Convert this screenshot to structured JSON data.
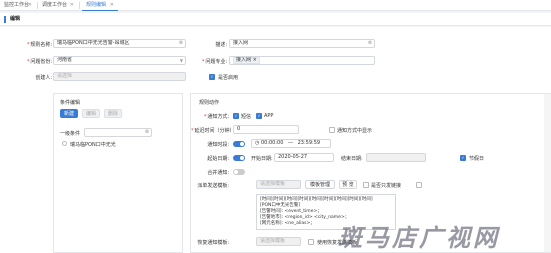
{
  "tabs": [
    {
      "label": "监控工作台"
    },
    {
      "label": "调度工作台"
    },
    {
      "label": "规则编辑"
    }
  ],
  "title": "编辑",
  "form": {
    "rule_name_label": "规则名称:",
    "rule_name_value": "瑞马临PON口中无光告警-昂城区",
    "description_label": "描述:",
    "description_value": "接入网",
    "region_label": "问题省份:",
    "region_value": "河南省",
    "specialty_label": "问题专业:",
    "specialty_chip": "接入网",
    "creator_label": "创建人:",
    "creator_placeholder": "请选择",
    "enabled_label": "是否启用"
  },
  "condition": {
    "title": "条件编辑",
    "btn_new": "新建",
    "btn_edit": "编辑",
    "btn_delete": "删除",
    "group_label": "一级条件",
    "tree_item": "瑞马临PON口中无光"
  },
  "action": {
    "title": "规则动作",
    "notify_label": "通知方式:",
    "notify_sms": "短信",
    "notify_app": "APP",
    "delay_label": "延迟时间（分钟）:",
    "delay_value": "0",
    "delay_check": "通知方式中显示",
    "period_label": "通知时段:",
    "period_toggle": "开启",
    "period_start": "00:00:00",
    "period_sep": "—",
    "period_end": "23:59:59",
    "date_label": "起始日期:",
    "date_toggle": "开启",
    "start_date_label": "开始日期:",
    "start_date": "2020-05-27",
    "end_date_label": "结束日期:",
    "holiday_label": "节假日",
    "merge_label": "合并通知:",
    "template_label": "派单发送模板:",
    "template_placeholder": "请选择模板",
    "template_btn": "模板管理",
    "preview_btn": "预 览",
    "auto_send_label": "是否只发链接",
    "msg_lines": [
      "[时间][时间][时间][时间][时间][时间][时间][时间][时间]",
      "[PON口中无光告警]",
      "[告警时间]: <event_time>；",
      "[告警地市]: <region_id> <city_name>；",
      "[网元名称]: <ne_alias>；"
    ],
    "recover_label": "恢复通知模板:",
    "recover_placeholder": "请选择模板",
    "recover_check": "使用恢复发送模板"
  },
  "watermark": "斑马店广视网",
  "colors": {
    "accent": "#3a7bd5"
  }
}
